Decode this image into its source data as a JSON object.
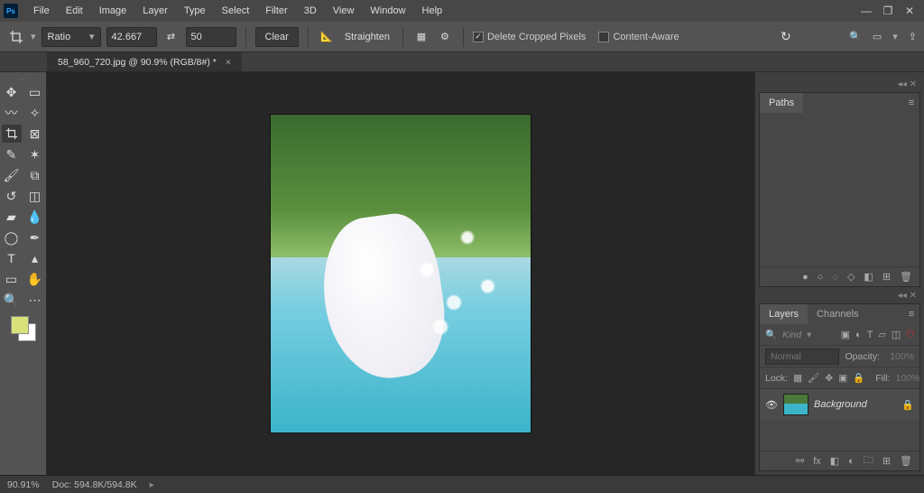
{
  "menubar": {
    "items": [
      "File",
      "Edit",
      "Image",
      "Layer",
      "Type",
      "Select",
      "Filter",
      "3D",
      "View",
      "Window",
      "Help"
    ]
  },
  "optbar": {
    "ratioLabel": "Ratio",
    "valW": "42.667",
    "valH": "50",
    "clear": "Clear",
    "straighten": "Straighten",
    "deleteCropped": "Delete Cropped Pixels",
    "contentAware": "Content-Aware"
  },
  "doc": {
    "tab": "58_960_720.jpg @ 90.9% (RGB/8#) *"
  },
  "paths": {
    "tab": "Paths"
  },
  "layers": {
    "tab": "Layers",
    "tab2": "Channels",
    "kind": "Kind",
    "blend": "Normal",
    "opacityLbl": "Opacity:",
    "opacityVal": "100%",
    "lockLbl": "Lock:",
    "fillLbl": "Fill:",
    "fillVal": "100%",
    "layerName": "Background"
  },
  "status": {
    "zoom": "90.91%",
    "doc": "Doc: 594.8K/594.8K"
  }
}
